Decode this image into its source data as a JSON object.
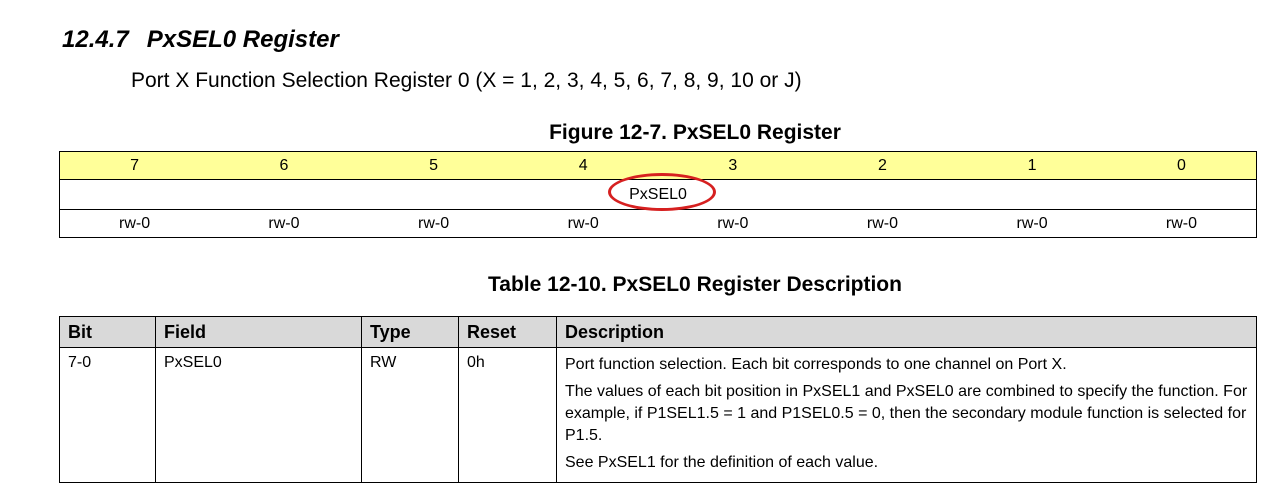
{
  "heading": {
    "number": "12.4.7",
    "title": "PxSEL0 Register"
  },
  "subtitle": "Port X Function Selection Register 0 (X = 1, 2, 3, 4, 5, 6, 7, 8, 9, 10 or J)",
  "figure": {
    "caption": "Figure 12-7. PxSEL0 Register",
    "bits": [
      "7",
      "6",
      "5",
      "4",
      "3",
      "2",
      "1",
      "0"
    ],
    "field": "PxSEL0",
    "access": [
      "rw-0",
      "rw-0",
      "rw-0",
      "rw-0",
      "rw-0",
      "rw-0",
      "rw-0",
      "rw-0"
    ],
    "highlight_color": "#d62020",
    "bit_row_color": "#ffff99"
  },
  "table": {
    "caption": "Table 12-10. PxSEL0 Register Description",
    "headers": [
      "Bit",
      "Field",
      "Type",
      "Reset",
      "Description"
    ],
    "header_color": "#d9d9d9",
    "row": {
      "bit": "7-0",
      "field": "PxSEL0",
      "type": "RW",
      "reset": "0h",
      "description": [
        "Port function selection. Each bit corresponds to one channel on Port X.",
        "The values of each bit position in PxSEL1 and PxSEL0 are combined to specify the function. For example, if P1SEL1.5 = 1 and P1SEL0.5 = 0, then the secondary module function is selected for P1.5.",
        "See PxSEL1 for the definition of each value."
      ]
    }
  }
}
